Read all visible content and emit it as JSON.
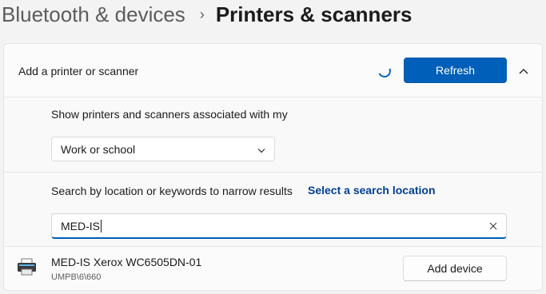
{
  "breadcrumb": {
    "parent": "Bluetooth & devices",
    "separator": "›",
    "current": "Printers & scanners"
  },
  "add_panel": {
    "title": "Add a printer or scanner",
    "refresh_label": "Refresh",
    "expanded": true,
    "accent_color": "#005fb8"
  },
  "association": {
    "label": "Show printers and scanners associated with my",
    "selected": "Work or school"
  },
  "search": {
    "label": "Search by location or keywords to narrow results",
    "link": "Select a search location",
    "value": "MED-IS"
  },
  "devices": [
    {
      "name": "MED-IS Xerox WC6505DN-01",
      "location": "UMPB\\6\\660",
      "action": "Add device",
      "icon": "printer-icon"
    }
  ]
}
